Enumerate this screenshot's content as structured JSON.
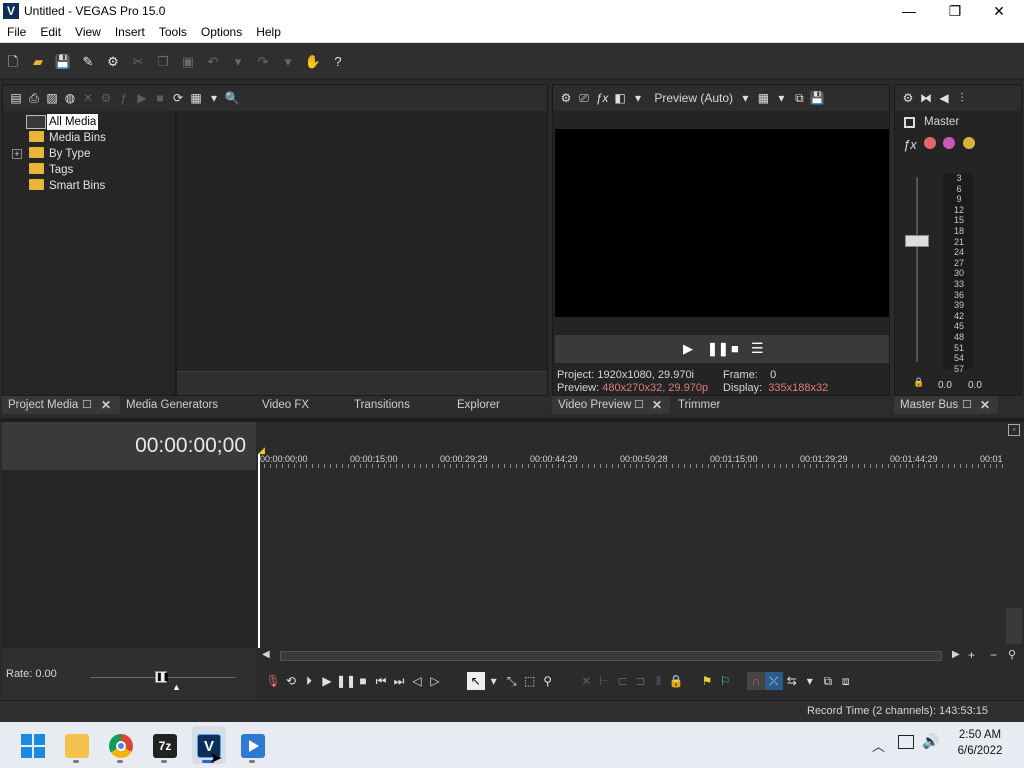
{
  "window": {
    "title": "Untitled - VEGAS Pro 15.0",
    "logo_letter": "V",
    "controls": {
      "minimize": "—",
      "maximize": "❐",
      "close": "✕"
    }
  },
  "menu": [
    "File",
    "Edit",
    "View",
    "Insert",
    "Tools",
    "Options",
    "Help"
  ],
  "media_panel": {
    "tree": [
      {
        "label": "All Media",
        "selected": true,
        "expandable": false
      },
      {
        "label": "Media Bins",
        "expandable": false
      },
      {
        "label": "By Type",
        "expandable": true
      },
      {
        "label": "Tags",
        "expandable": false
      },
      {
        "label": "Smart Bins",
        "expandable": false
      }
    ],
    "expand_glyph": "+"
  },
  "preview": {
    "mode": "Preview (Auto)",
    "project_label": "Project:",
    "project_value": "1920x1080, 29.970i",
    "frame_label": "Frame:",
    "frame_value": "0",
    "preview_label": "Preview:",
    "preview_value": "480x270x32, 29.970p",
    "display_label": "Display:",
    "display_value": "335x188x32",
    "value_color": "#e07b7b"
  },
  "mixer": {
    "master_label": "Master",
    "meter_scale": [
      "3",
      "6",
      "9",
      "12",
      "15",
      "18",
      "21",
      "24",
      "27",
      "30",
      "33",
      "36",
      "39",
      "42",
      "45",
      "48",
      "51",
      "54",
      "57"
    ],
    "left_value": "0.0",
    "right_value": "0.0"
  },
  "tabs_left": [
    "Project Media",
    "Media Generators",
    "Video FX",
    "Transitions",
    "Explorer"
  ],
  "tabs_mid": [
    "Video Preview",
    "Trimmer"
  ],
  "tabs_right": [
    "Master Bus"
  ],
  "timeline": {
    "timecode": "00:00:00;00",
    "ruler": [
      "00:00:00;00",
      "00:00:15;00",
      "00:00:29;29",
      "00:00:44;29",
      "00:00:59;28",
      "00:01:15;00",
      "00:01:29;29",
      "00:01:44;29",
      "00:01"
    ],
    "rate": "Rate: 0.00",
    "record_time": "Record Time (2 channels): 143:53:15"
  },
  "taskbar": {
    "time": "2:50 AM",
    "date": "6/6/2022",
    "apps": [
      "start",
      "file-explorer",
      "chrome",
      "7zip",
      "vegas",
      "media-player"
    ],
    "zip_label": "7z",
    "vegas_label": "V"
  }
}
